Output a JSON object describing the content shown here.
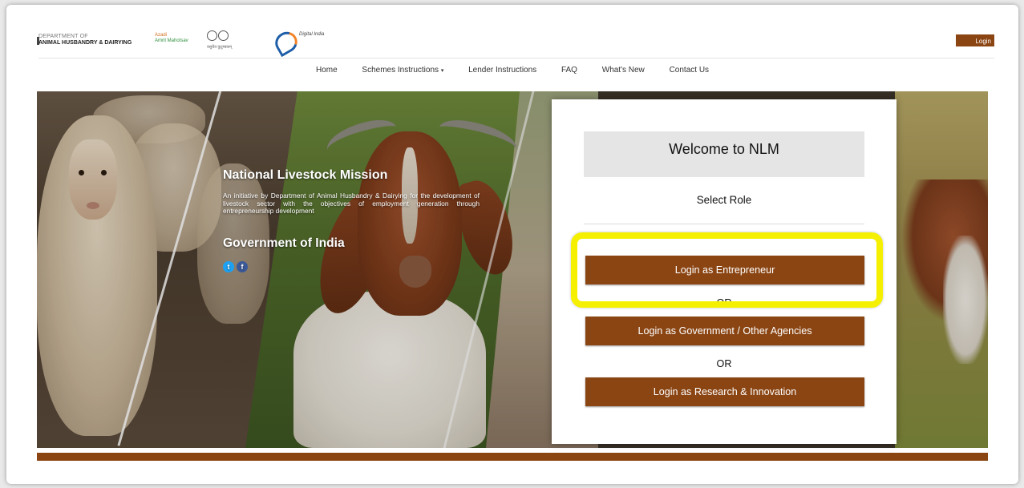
{
  "header": {
    "dept_line1": "DEPARTMENT OF",
    "dept_line2": "ANIMAL HUSBANDRY & DAIRYING",
    "azadi_line1": "Azadi",
    "azadi_line2": "Amrit Mahotsav",
    "g20_text": "वसुधैव कुटुम्बकम्",
    "digital_india": "Digital India",
    "login_label": "Login"
  },
  "nav": {
    "items": [
      "Home",
      "Schemes Instructions",
      "Lender Instructions",
      "FAQ",
      "What's New",
      "Contact Us"
    ],
    "dropdown_caret": "▾"
  },
  "hero": {
    "title": "National Livestock Mission",
    "description": "An initiative by Department of Animal Husbandry & Dairying for the development of livestock sector with the objectives of employment generation through entrepreneurship development",
    "subtitle": "Government of India",
    "social": {
      "twitter_glyph": "t",
      "facebook_glyph": "f"
    }
  },
  "panel": {
    "welcome": "Welcome to NLM",
    "select_role": "Select Role",
    "btn_entrepreneur": "Login as Entrepreneur",
    "or1": "OR",
    "btn_government": "Login as Government / Other Agencies",
    "or2": "OR",
    "btn_research": "Login as Research & Innovation"
  },
  "colors": {
    "brand_brown": "#8b4513",
    "highlight_yellow": "#f5f000",
    "twitter": "#1da1f2",
    "facebook": "#3b5998"
  }
}
